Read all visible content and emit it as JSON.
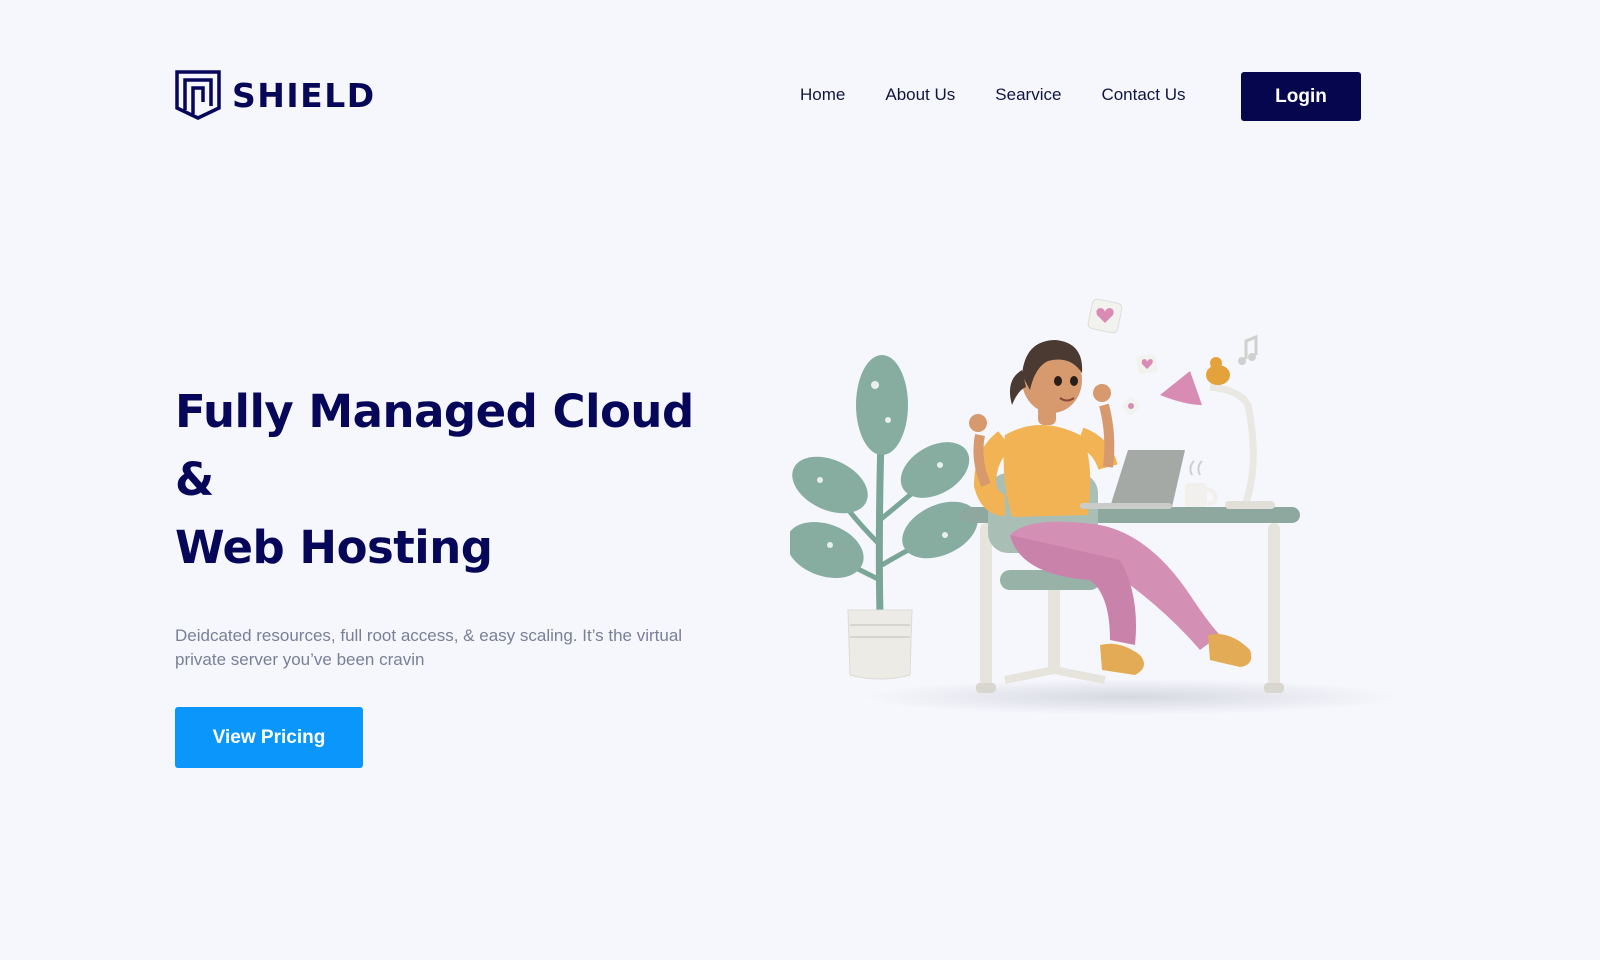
{
  "brand": {
    "name": "SHIELD",
    "logo_icon": "shield-logo-icon",
    "color": "#07075a"
  },
  "nav": {
    "items": [
      {
        "label": "Home"
      },
      {
        "label": "About Us"
      },
      {
        "label": "Searvice"
      },
      {
        "label": "Contact Us"
      }
    ],
    "login_label": "Login"
  },
  "hero": {
    "title_line1": "Fully Managed Cloud &",
    "title_line2": "Web Hosting",
    "description": "Deidcated resources, full root access, & easy scaling. It’s the virtual private server you’ve been cravin",
    "cta_label": "View Pricing"
  },
  "illustration": {
    "subject": "woman-at-desk-illustration"
  },
  "colors": {
    "background": "#f6f7fc",
    "navy": "#06064f",
    "accent_blue": "#0a96fb",
    "muted_text": "#7a7f99"
  }
}
